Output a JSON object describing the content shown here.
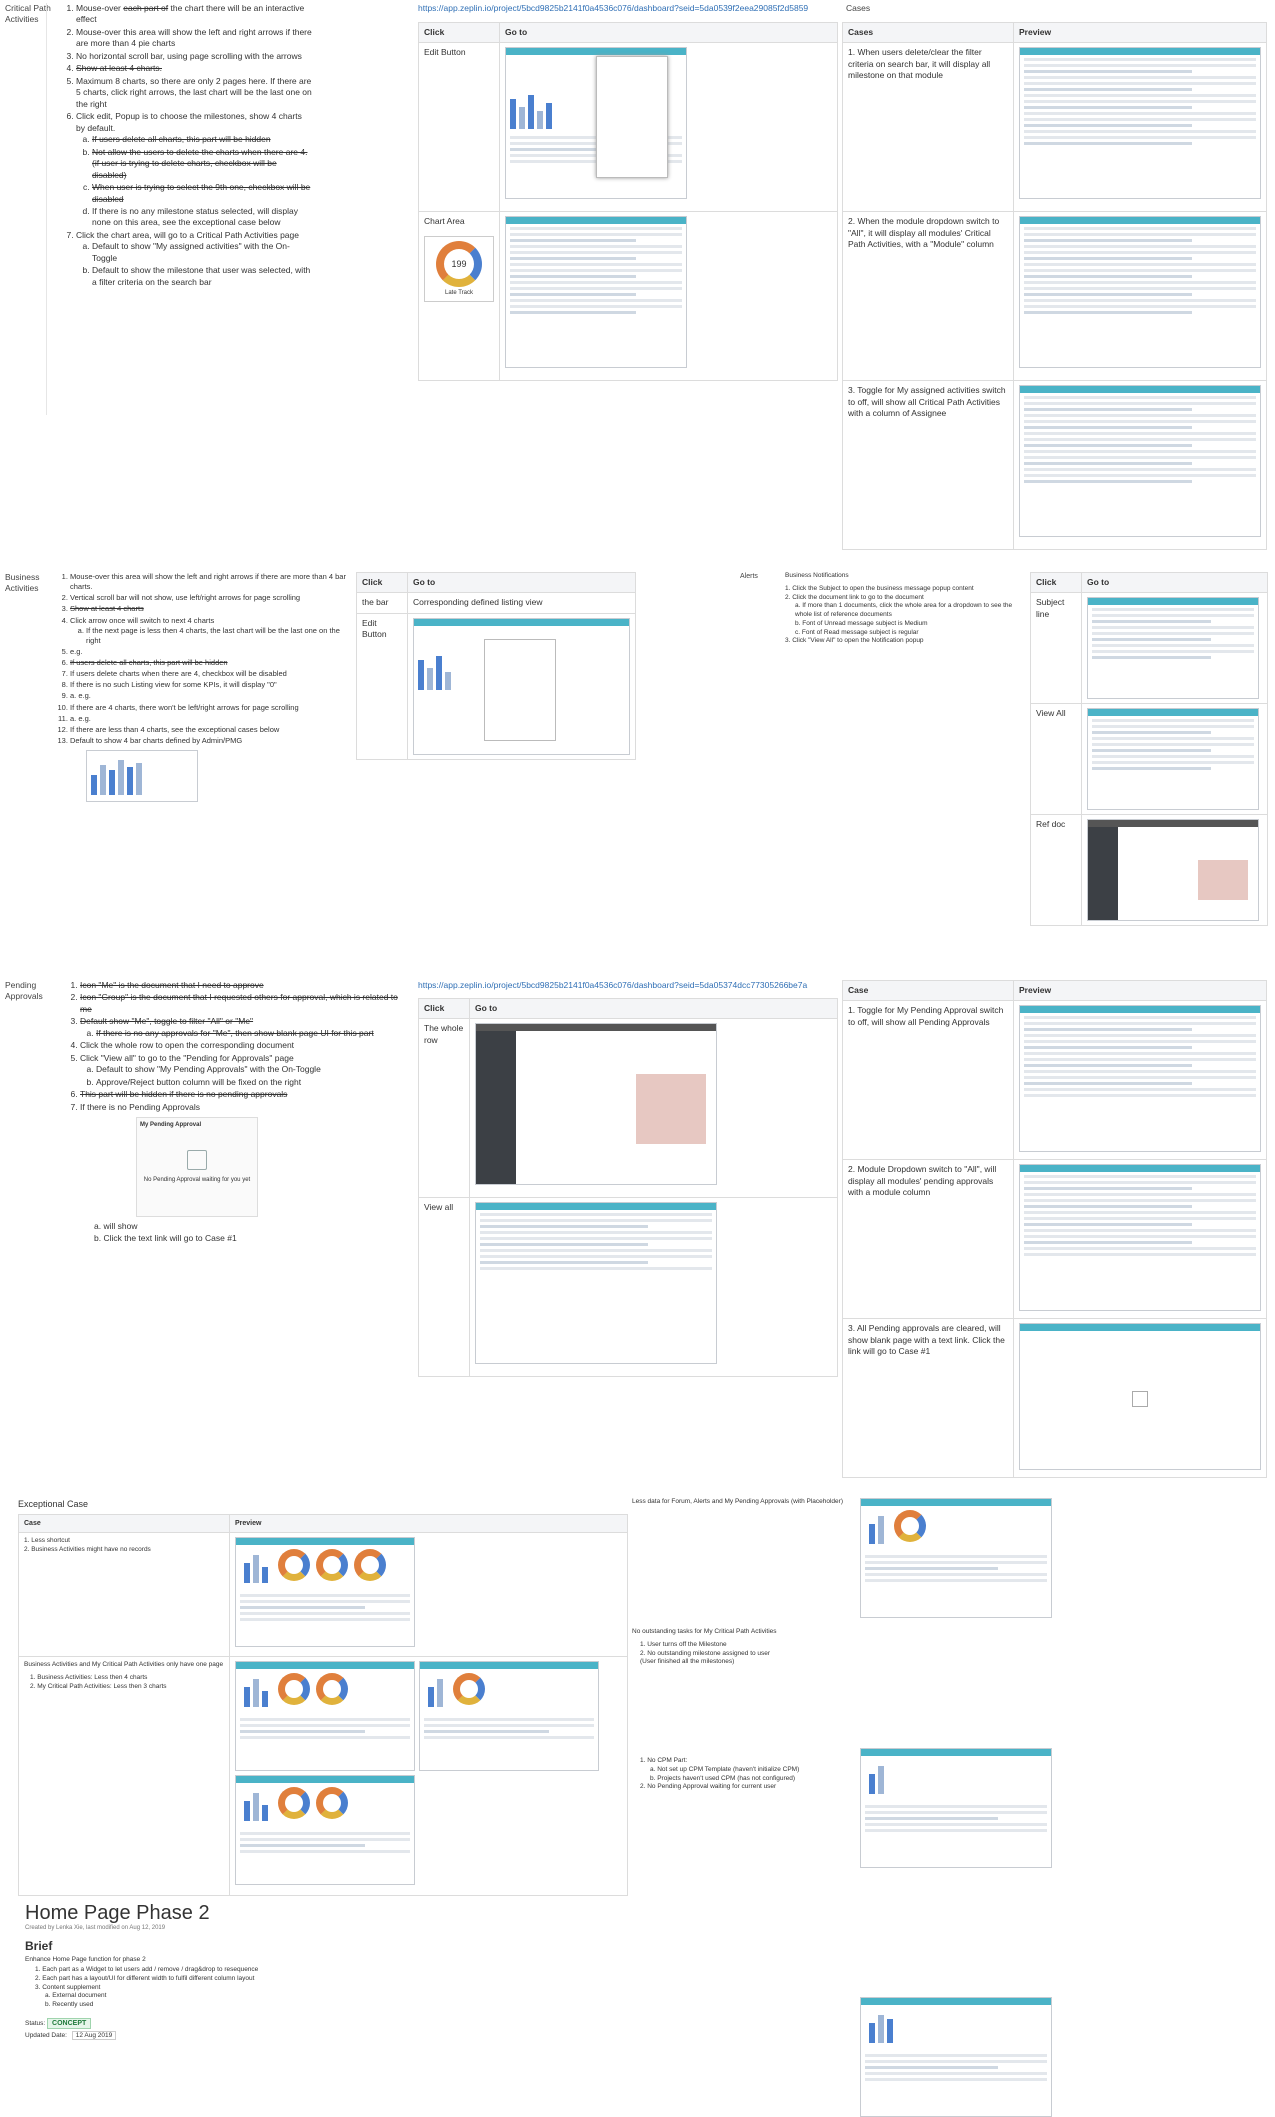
{
  "cpa": {
    "label": "Critical Path Activities",
    "items": [
      {
        "pre": "Mouse-over ",
        "strike": "each part of",
        "post": " the chart there will be an interactive effect"
      },
      {
        "text": "Mouse-over this area will show the left and right arrows if there are more than 4 pie charts"
      },
      {
        "text": "No horizontal scroll bar, using page scrolling with the arrows"
      },
      {
        "strike_full": "Show at least 4 charts."
      },
      {
        "text": "Maximum 8 charts, so there are only 2 pages here. If there are 5 charts, click right arrows, the last chart will be the last one on the right"
      },
      {
        "text": "Click edit, Popup is to choose the milestones, show 4 charts by default.",
        "sub": [
          {
            "strike_full": "If users delete all charts, this part will be hidden"
          },
          {
            "strike_full": "Not allow the users to delete the charts when there are 4. (if user is trying to delete charts, checkbox will be disabled)"
          },
          {
            "strike_full": "When user is trying to select the 9th one, checkbox will be disabled"
          },
          {
            "text": "If there is no any milestone status selected, will display none on this area, see the exceptional case below"
          }
        ]
      },
      {
        "text": "Click the chart area, will go to a Critical Path Activities page",
        "sub": [
          {
            "text": "Default to show \"My assigned activities\" with the On-Toggle"
          },
          {
            "text": "Default to show the milestone that user was selected, with a filter criteria on the search bar"
          }
        ]
      }
    ],
    "link": "https://app.zeplin.io/project/5bcd9825b2141f0a4536c076/dashboard?seid=5da0539f2eea29085f2d5859",
    "click_header": "Click",
    "goto_header": "Go to",
    "rows": [
      {
        "click": "Edit Button"
      },
      {
        "click": "Chart Area",
        "donut_value": "199",
        "donut_label": "Late Track"
      }
    ],
    "cases_title": "Cases",
    "case_header": "Cases",
    "preview_header": "Preview",
    "cases": [
      {
        "text": "1.  When users delete/clear the filter criteria on search bar, it will display all milestone on that module"
      },
      {
        "text": "2.  When the module dropdown switch to \"All\", it will display all modules' Critical Path Activities, with a \"Module\" column"
      },
      {
        "text": "3.  Toggle for My assigned activities switch to off, will show all Critical Path Activities with a column of Assignee"
      }
    ]
  },
  "ba": {
    "label": "Business Activities",
    "items": [
      {
        "text": "Mouse-over this area will show the left and right arrows if there are more than 4 bar charts."
      },
      {
        "text": "Vertical scroll bar will not show, use left/right arrows for page scrolling"
      },
      {
        "strike_full": "Show at least 4 charts"
      },
      {
        "text": "Click arrow once will switch to next 4 charts",
        "sub": [
          {
            "text": "If the next page is less then 4 charts, the last chart will be the last one on the right"
          }
        ]
      },
      {
        "text": "e.g."
      },
      {
        "strike_full": "If users delete all charts, this part will be hidden"
      },
      {
        "text": "If users delete charts when there are 4, checkbox will be disabled"
      },
      {
        "text": "If there is no such Listing view for some KPIs, it will display \"0\""
      },
      {
        "text": "a. e.g."
      },
      {
        "text": "If there are 4 charts, there won't be left/right arrows for page scrolling"
      },
      {
        "text": "a. e.g."
      },
      {
        "text": "If there are less than 4 charts, see the exceptional cases below"
      },
      {
        "text": "Default to show 4 bar charts defined by Admin/PMG"
      }
    ],
    "click_header": "Click",
    "goto_header": "Go to",
    "rows": [
      {
        "click": "the bar",
        "goto": "Corresponding defined listing view"
      },
      {
        "click": "Edit Button",
        "goto": ""
      }
    ]
  },
  "alerts": {
    "label": "Alerts",
    "title": "Business Notifications",
    "items": [
      "1. Click the Subject to open the business message popup content",
      "2. Click the document link to go to the document",
      "a. If more than 1 documents, click the whole area for a dropdown to see the whole list of reference documents",
      "b. Font of Unread message subject is Medium",
      "c. Font of Read message subject is regular",
      "3. Click \"View All\" to open the Notification popup"
    ],
    "click_header": "Click",
    "goto_header": "Go to",
    "rows": [
      {
        "click": "Subject line"
      },
      {
        "click": "View All"
      },
      {
        "click": "Ref doc"
      }
    ]
  },
  "pa": {
    "label": "Pending Approvals",
    "link": "https://app.zeplin.io/project/5bcd9825b2141f0a4536c076/dashboard?seid=5da05374dcc77305266be7a",
    "items": [
      {
        "strike_full": "Icon \"Me\" is the document that I need to approve"
      },
      {
        "strike_full": "Icon \"Group\" is the document that I requested others for approval, which is related to me"
      },
      {
        "strike_full": "Default show \"Me\", toggle to filter \"All\" or \"Me\"",
        "sub": [
          {
            "strike_full": "If there is no any approvals for \"Me\", then show blank page UI for this part"
          }
        ]
      },
      {
        "text": "Click the whole row to open the corresponding document"
      },
      {
        "text": "Click \"View all\" to go to the \"Pending for Approvals\" page",
        "sub": [
          {
            "text": "Default to show \"My Pending Approvals\" with the On-Toggle"
          },
          {
            "text": "Approve/Reject button column will be fixed on the right"
          }
        ]
      },
      {
        "strike_full": "This part will be hidden if there is no pending approvals"
      },
      {
        "text": "If there is no Pending Approvals"
      }
    ],
    "empty_card_title": "My Pending Approval",
    "empty_card_text": "No Pending Approval waiting for you yet",
    "after": [
      "a. will show",
      "b. Click the text link will go to Case #1"
    ],
    "click_header": "Click",
    "goto_header": "Go to",
    "rows": [
      {
        "click": "The whole row"
      },
      {
        "click": "View all"
      }
    ],
    "case_header": "Case",
    "preview_header": "Preview",
    "cases": [
      {
        "text": "1.  Toggle for My Pending Approval switch to off, will show all Pending Approvals"
      },
      {
        "text": "2.  Module Dropdown switch to \"All\", will display all modules' pending approvals with a module column"
      },
      {
        "text": "3.  All Pending approvals are cleared, will show blank page with a text link. Click the link will go to Case #1"
      }
    ]
  },
  "exceptional": {
    "title": "Exceptional Case",
    "case_header": "Case",
    "preview_header": "Preview",
    "case1": [
      "1. Less shortcut",
      "2. Business Activities might have no records"
    ],
    "case2_title": "Business Activities and My Critical Path Activities only have one page",
    "case2": [
      "1. Business Activities: Less then 4 charts",
      "2. My Critical Path Activities: Less then 3 charts"
    ],
    "right1": "Less data for Forum, Alerts and My Pending Approvals (with Placeholder)",
    "right2_title": "No outstanding tasks for My Critical Path Activities",
    "right2": [
      "1. User turns off the Milestone",
      "2. No outstanding milestone assigned to user",
      "(User finished all the milestones)"
    ],
    "right3": [
      "1. No CPM Part:",
      "a. Not set up CPM Template (haven't initialize CPM)",
      "b. Projects haven't used CPM (has not configured)",
      "2. No Pending Approval waiting for current user"
    ]
  },
  "home": {
    "title": "Home Page Phase 2",
    "meta": "Created by Lenka Xie, last modified on Aug 12, 2019",
    "brief": "Brief",
    "intro": "Enhance Home Page function for phase 2",
    "items": [
      "1. Each part as a Widget to let users add / remove / drag&drop to resequence",
      "2. Each part has a layout/UI for different width to fulfil different column layout",
      "3. Content supplement",
      "a. External document",
      "b. Recently used"
    ],
    "status_label": "Status:",
    "status": "CONCEPT",
    "updated_label": "Updated Date:",
    "updated": "12 Aug 2019"
  }
}
